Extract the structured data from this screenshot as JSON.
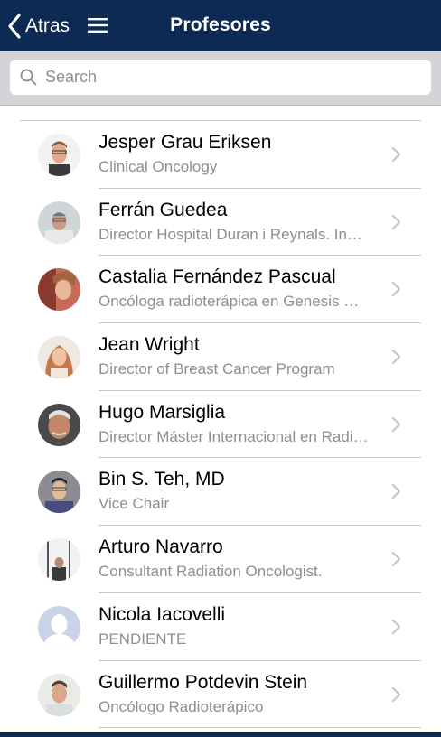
{
  "navbar": {
    "back_label": "Atras",
    "title": "Profesores",
    "back_icon": "chevron-left-icon",
    "menu_icon": "hamburger-menu-icon"
  },
  "search": {
    "placeholder": "Search",
    "value": "",
    "icon": "search-icon"
  },
  "colors": {
    "navbar": "#0d2a55",
    "searchbar": "#d2d4d8",
    "subtitle": "#8e8e93",
    "divider": "#c8c7cc",
    "chevron": "#c7c7cc"
  },
  "professors": [
    {
      "name": "Jesper Grau Eriksen",
      "subtitle": "Clinical Oncology"
    },
    {
      "name": "Ferrán Guedea",
      "subtitle": "Director Hospital Duran i Reynals. Institut Català d'Oncologia"
    },
    {
      "name": "Castalia Fernández Pascual",
      "subtitle": "Oncóloga radioterápica en Genesis Care"
    },
    {
      "name": "Jean Wright",
      "subtitle": "Director of Breast Cancer Program"
    },
    {
      "name": "Hugo Marsiglia",
      "subtitle": "Director Máster Internacional en Radioterapia"
    },
    {
      "name": "Bin S. Teh, MD",
      "subtitle": "Vice Chair"
    },
    {
      "name": "Arturo Navarro",
      "subtitle": "Consultant Radiation Oncologist."
    },
    {
      "name": "Nicola Iacovelli",
      "subtitle": "PENDIENTE"
    },
    {
      "name": "Guillermo Potdevin Stein",
      "subtitle": "Oncólogo Radioterápico"
    }
  ]
}
